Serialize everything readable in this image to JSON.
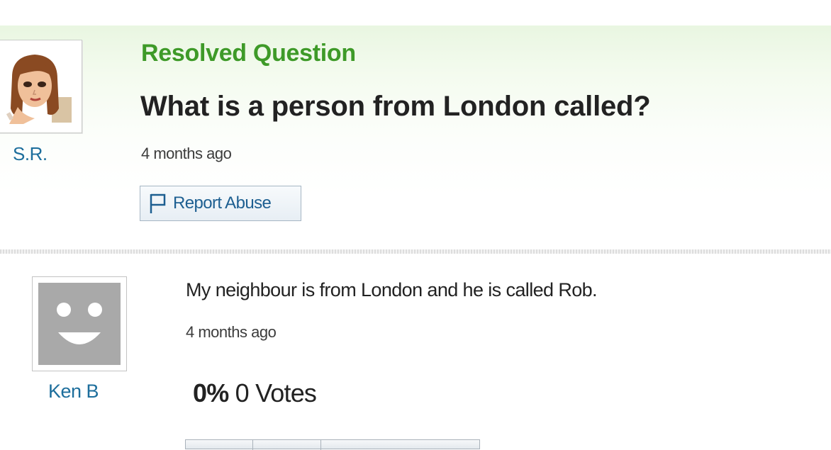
{
  "question": {
    "status_label": "Resolved Question",
    "title": "What is a person from London called?",
    "time": "4 months ago",
    "report_label": "Report Abuse",
    "asker": {
      "name": "S.R.",
      "avatar_icon": "cartoon-woman-avatar"
    }
  },
  "answer": {
    "text": "My neighbour is from London and he is called Rob.",
    "time": "4 months ago",
    "rating_percent": "0%",
    "votes_label": "0 Votes",
    "answerer": {
      "name": "Ken B",
      "avatar_icon": "smiley-face-avatar"
    }
  },
  "colors": {
    "status_green": "#3e9a28",
    "link_blue": "#1d6e9c",
    "header_gradient": "#e9f6e1"
  }
}
